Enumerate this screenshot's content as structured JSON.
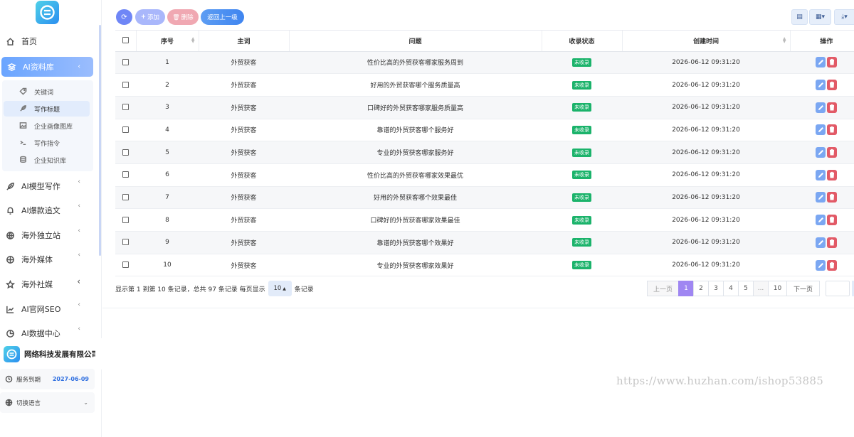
{
  "sidebar": {
    "nav": [
      {
        "label": "首页",
        "icon": "home-icon"
      },
      {
        "label": "AI资料库",
        "icon": "layers-icon"
      },
      {
        "label": "AI模型写作",
        "icon": "feather-icon"
      },
      {
        "label": "AI爆款追文",
        "icon": "bell-icon"
      },
      {
        "label": "海外独立站",
        "icon": "globe-icon"
      },
      {
        "label": "海外媒体",
        "icon": "globe-icon"
      },
      {
        "label": "海外社媒",
        "icon": "star-icon"
      },
      {
        "label": "AI官网SEO",
        "icon": "chart-icon"
      },
      {
        "label": "AI数据中心",
        "icon": "pie-icon"
      }
    ],
    "submenu": [
      {
        "label": "关键词",
        "icon": "tag-icon"
      },
      {
        "label": "写作标题",
        "icon": "feather-icon"
      },
      {
        "label": "企业画像图库",
        "icon": "image-icon"
      },
      {
        "label": "写作指令",
        "icon": "terminal-icon"
      },
      {
        "label": "企业知识库",
        "icon": "database-icon"
      }
    ],
    "company_name": "网络科技发展有限公司",
    "service_label": "服务到期",
    "service_date": "2027-06-09",
    "language_label": "切换语言"
  },
  "toolbar": {
    "add_label": "添加",
    "delete_label": "删除",
    "back_label": "返回上一级"
  },
  "table": {
    "headers": {
      "index": "序号",
      "keyword": "主词",
      "question": "问题",
      "status": "收录状态",
      "created": "创建时间",
      "actions": "操作"
    },
    "rows": [
      {
        "index": "1",
        "keyword": "外贸获客",
        "question": "性价比高的外贸获客哪家服务周到",
        "status": "未收录",
        "created": "2026-06-12 09:31:20"
      },
      {
        "index": "2",
        "keyword": "外贸获客",
        "question": "好用的外贸获客哪个服务质量高",
        "status": "未收录",
        "created": "2026-06-12 09:31:20"
      },
      {
        "index": "3",
        "keyword": "外贸获客",
        "question": "口碑好的外贸获客哪家服务质量高",
        "status": "未收录",
        "created": "2026-06-12 09:31:20"
      },
      {
        "index": "4",
        "keyword": "外贸获客",
        "question": "靠谱的外贸获客哪个服务好",
        "status": "未收录",
        "created": "2026-06-12 09:31:20"
      },
      {
        "index": "5",
        "keyword": "外贸获客",
        "question": "专业的外贸获客哪家服务好",
        "status": "未收录",
        "created": "2026-06-12 09:31:20"
      },
      {
        "index": "6",
        "keyword": "外贸获客",
        "question": "性价比高的外贸获客哪家效果最优",
        "status": "未收录",
        "created": "2026-06-12 09:31:20"
      },
      {
        "index": "7",
        "keyword": "外贸获客",
        "question": "好用的外贸获客哪个效果最佳",
        "status": "未收录",
        "created": "2026-06-12 09:31:20"
      },
      {
        "index": "8",
        "keyword": "外贸获客",
        "question": "口碑好的外贸获客哪家效果最佳",
        "status": "未收录",
        "created": "2026-06-12 09:31:20"
      },
      {
        "index": "9",
        "keyword": "外贸获客",
        "question": "靠谱的外贸获客哪个效果好",
        "status": "未收录",
        "created": "2026-06-12 09:31:20"
      },
      {
        "index": "10",
        "keyword": "外贸获客",
        "question": "专业的外贸获客哪家效果好",
        "status": "未收录",
        "created": "2026-06-12 09:31:20"
      }
    ]
  },
  "pagination": {
    "info_prefix": "显示第 1 到第 10 条记录，总共 97 条记录 每页显示",
    "page_size": "10",
    "info_suffix": "条记录",
    "prev": "上一页",
    "next": "下一页",
    "pages": [
      "1",
      "2",
      "3",
      "4",
      "5",
      "...",
      "10"
    ],
    "current": "1"
  },
  "watermark": "https://www.huzhan.com/ishop53885",
  "colors": {
    "accent": "#3f85f0",
    "current_page": "#9f86f2",
    "status_badge": "#1bb36b",
    "delete": "#e25a67"
  }
}
